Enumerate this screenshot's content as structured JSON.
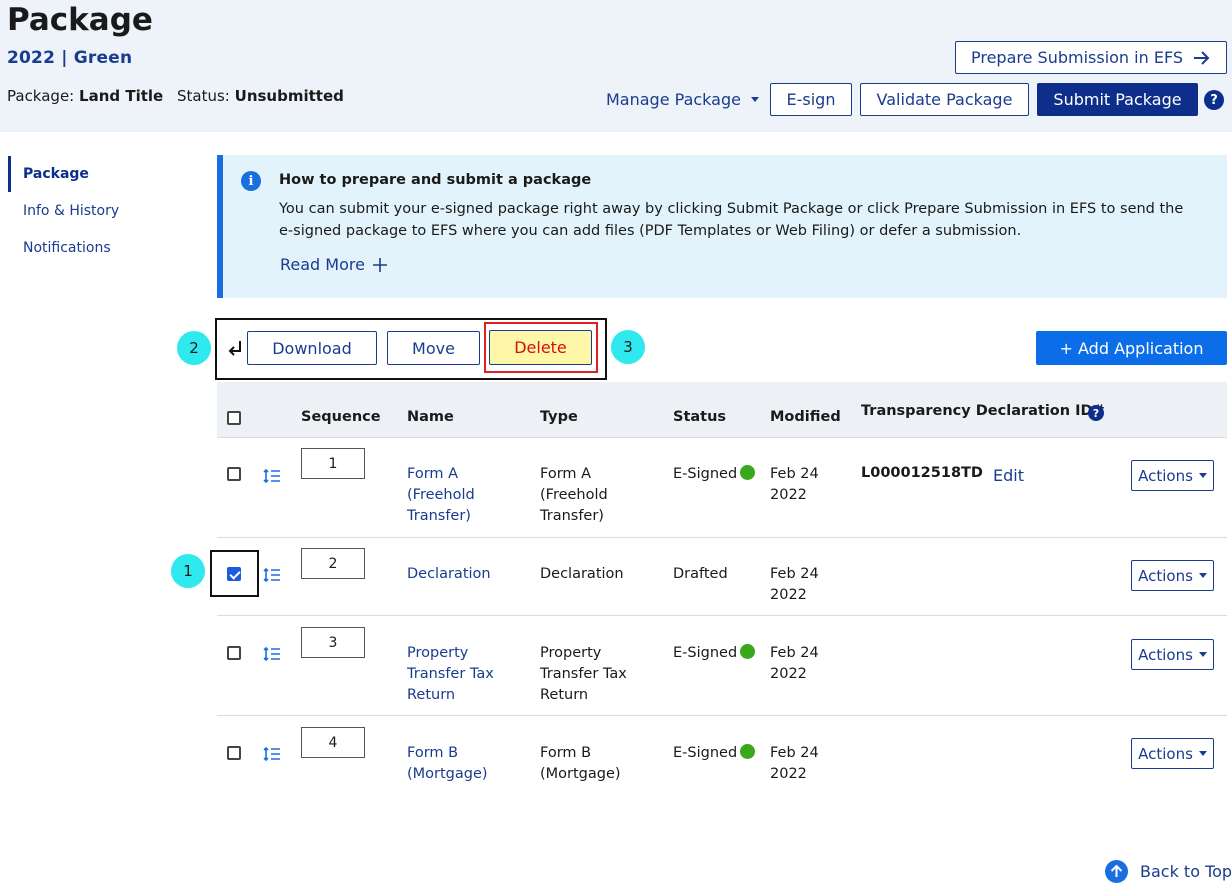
{
  "header": {
    "title": "Package",
    "subtitle": "2022 | Green",
    "package_label": "Package:",
    "package_value": "Land Title",
    "status_label": "Status:",
    "status_value": "Unsubmitted",
    "prepare_efs": "Prepare Submission in EFS",
    "manage_package": "Manage Package",
    "esign": "E-sign",
    "validate": "Validate Package",
    "submit": "Submit Package",
    "help": "?"
  },
  "sidebar": {
    "items": [
      {
        "label": "Package"
      },
      {
        "label": "Info & History"
      },
      {
        "label": "Notifications"
      }
    ]
  },
  "info": {
    "icon": "i",
    "title": "How to prepare and submit a package",
    "text": "You can submit your e-signed package right away by clicking Submit Package or click Prepare Submission in EFS to send the e-signed package to EFS where you can add files (PDF Templates or Web Filing) or defer a submission.",
    "read_more": "Read More"
  },
  "toolbar": {
    "download": "Download",
    "move": "Move",
    "delete": "Delete",
    "add_application": "+ Add Application"
  },
  "badges": [
    "1",
    "2",
    "3"
  ],
  "table": {
    "headers": {
      "sequence": "Sequence",
      "name": "Name",
      "type": "Type",
      "status": "Status",
      "modified": "Modified",
      "declaration": "Transparency Declaration ID#"
    },
    "rows": [
      {
        "seq": "1",
        "name": "Form A (Freehold Transfer)",
        "type": "Form A (Freehold Transfer)",
        "status": "E-Signed",
        "modified": "Feb 24 2022",
        "declaration_id": "L000012518TD",
        "edit": "Edit",
        "actions": "Actions",
        "checked": false
      },
      {
        "seq": "2",
        "name": "Declaration",
        "type": "Declaration",
        "status": "Drafted",
        "modified": "Feb 24 2022",
        "actions": "Actions",
        "checked": true
      },
      {
        "seq": "3",
        "name": "Property Transfer Tax Return",
        "type": "Property Transfer Tax Return",
        "status": "E-Signed",
        "modified": "Feb 24 2022",
        "actions": "Actions",
        "checked": false
      },
      {
        "seq": "4",
        "name": "Form B (Mortgage)",
        "type": "Form B (Mortgage)",
        "status": "E-Signed",
        "modified": "Feb 24 2022",
        "actions": "Actions",
        "checked": false
      }
    ]
  },
  "footer": {
    "back_to_top": "Back to Top"
  },
  "colors": {
    "header_bg": "#eef3f9",
    "primary": "#0d2e8a",
    "accent": "#0b6ee8",
    "signed": "#3aa81c",
    "info_bg": "#e3f3fb",
    "badge": "#2ee9ee",
    "delete_bg": "#fff7a8",
    "delete_text": "#d01010"
  }
}
